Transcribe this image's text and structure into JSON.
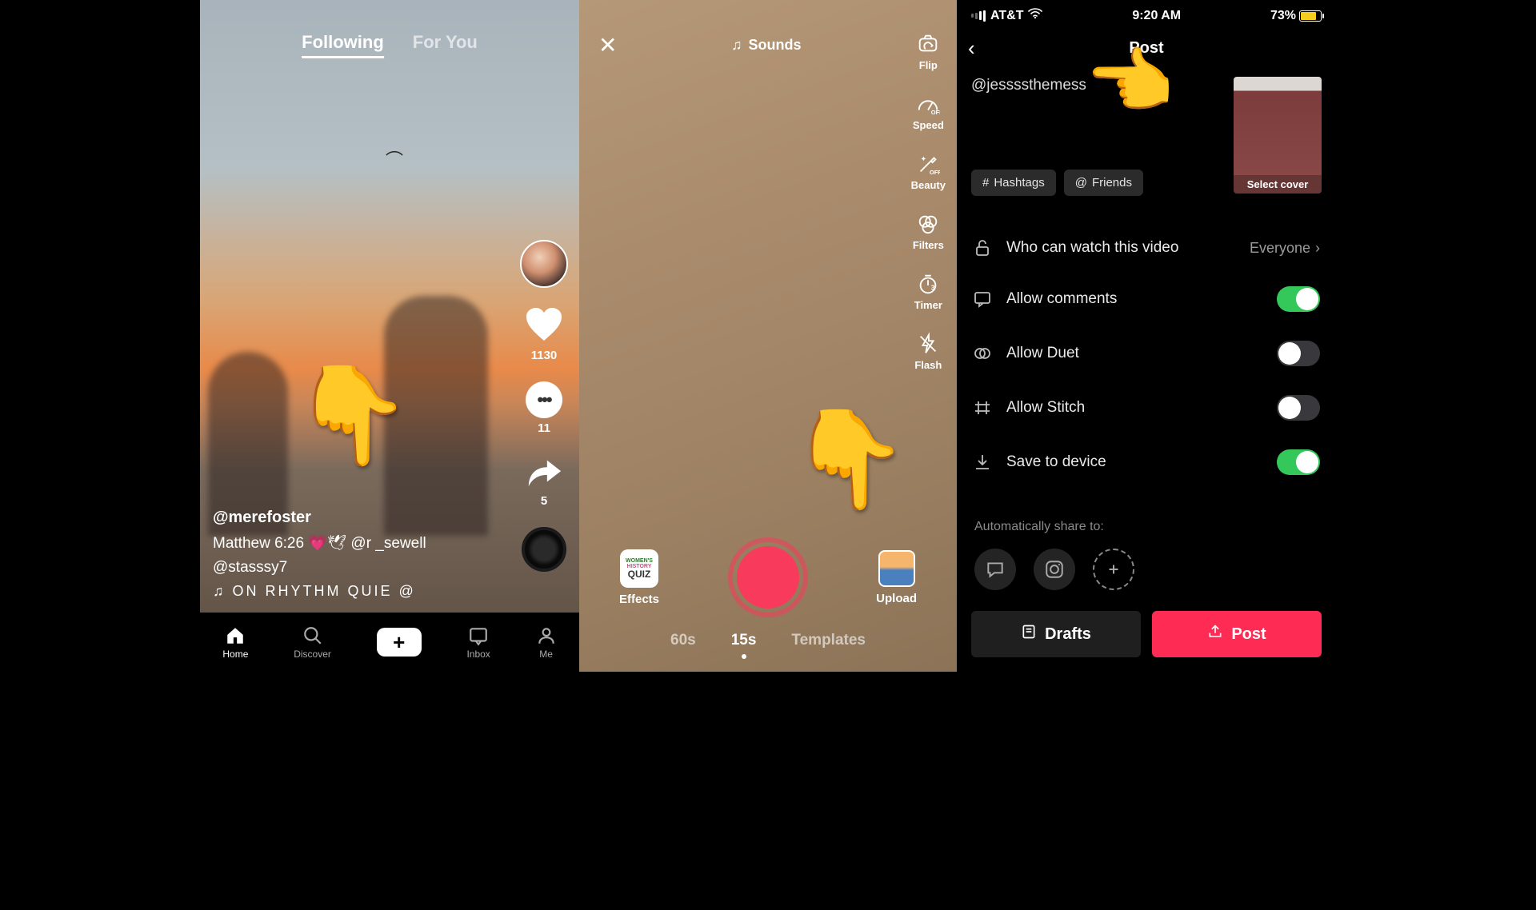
{
  "screen1": {
    "tabs": {
      "following": "Following",
      "for_you": "For You"
    },
    "side": {
      "likes": "1130",
      "comments": "11",
      "shares": "5"
    },
    "meta": {
      "username": "@merefoster",
      "caption": "Matthew 6:26 💗🕊 @r      _sewell",
      "tag": "@stasssy7",
      "marquee": "ON RHYTHM    QUIE     @"
    },
    "nav": {
      "home": "Home",
      "discover": "Discover",
      "inbox": "Inbox",
      "me": "Me"
    }
  },
  "screen2": {
    "sounds": "Sounds",
    "side": {
      "flip": "Flip",
      "speed": "Speed",
      "beauty": "Beauty",
      "filters": "Filters",
      "timer": "Timer",
      "flash": "Flash"
    },
    "effects_tile": {
      "l1": "WOMEN'S",
      "l2": "HISTORY",
      "l3": "QUIZ"
    },
    "bottom": {
      "effects": "Effects",
      "upload": "Upload"
    },
    "durations": {
      "d60": "60s",
      "d15": "15s",
      "templates": "Templates"
    }
  },
  "screen3": {
    "status": {
      "carrier": "AT&T",
      "time": "9:20 AM",
      "battery_pct": "73%"
    },
    "title": "Post",
    "caption": "@jessssthemess",
    "cover_label": "Select cover",
    "chips": {
      "hashtags": "Hashtags",
      "friends": "Friends"
    },
    "rows": {
      "privacy_label": "Who can watch this video",
      "privacy_value": "Everyone",
      "comments": "Allow comments",
      "duet": "Allow Duet",
      "stitch": "Allow Stitch",
      "save": "Save to device"
    },
    "share_label": "Automatically share to:",
    "buttons": {
      "drafts": "Drafts",
      "post": "Post"
    }
  }
}
